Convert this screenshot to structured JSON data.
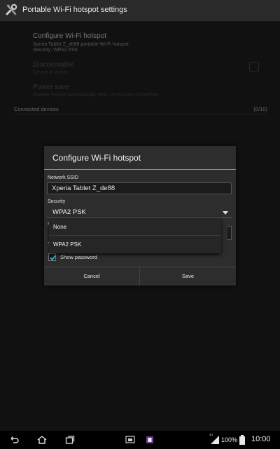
{
  "action_bar": {
    "title": "Portable Wi-Fi hotspot settings",
    "icon": "tools-icon"
  },
  "settings": {
    "configure": {
      "title": "Configure Wi-Fi hotspot",
      "summary_line1": "Xperia Tablet Z_de88 portable Wi-Fi hotspot",
      "summary_line2": "Security: WPA2 PSK"
    },
    "discoverable": {
      "title": "Discoverable",
      "summary": "Device is visible"
    },
    "power_save": {
      "title": "Power save",
      "summary": "Disable hotspot automatically after 10 minutes of inactivity"
    },
    "connected_devices": {
      "label": "Connected devices",
      "count": "(0/10)"
    }
  },
  "dialog": {
    "title": "Configure Wi-Fi hotspot",
    "ssid_label": "Network SSID",
    "ssid_value": "Xperia Tablet Z_de88",
    "security_label": "Security",
    "security_value": "WPA2 PSK",
    "password_label_stub": "P",
    "type_label_stub": "T",
    "show_password_label": "Show password",
    "show_password_checked": true,
    "cancel_label": "Cancel",
    "save_label": "Save"
  },
  "dropdown": {
    "options": [
      "None",
      "WPA2 PSK"
    ]
  },
  "status_bar": {
    "network": "3G",
    "battery": "100%",
    "time": "10:00"
  },
  "colors": {
    "accent": "#33b5e5",
    "background": "#1f1f1f",
    "dialog": "#2d2d2d"
  }
}
